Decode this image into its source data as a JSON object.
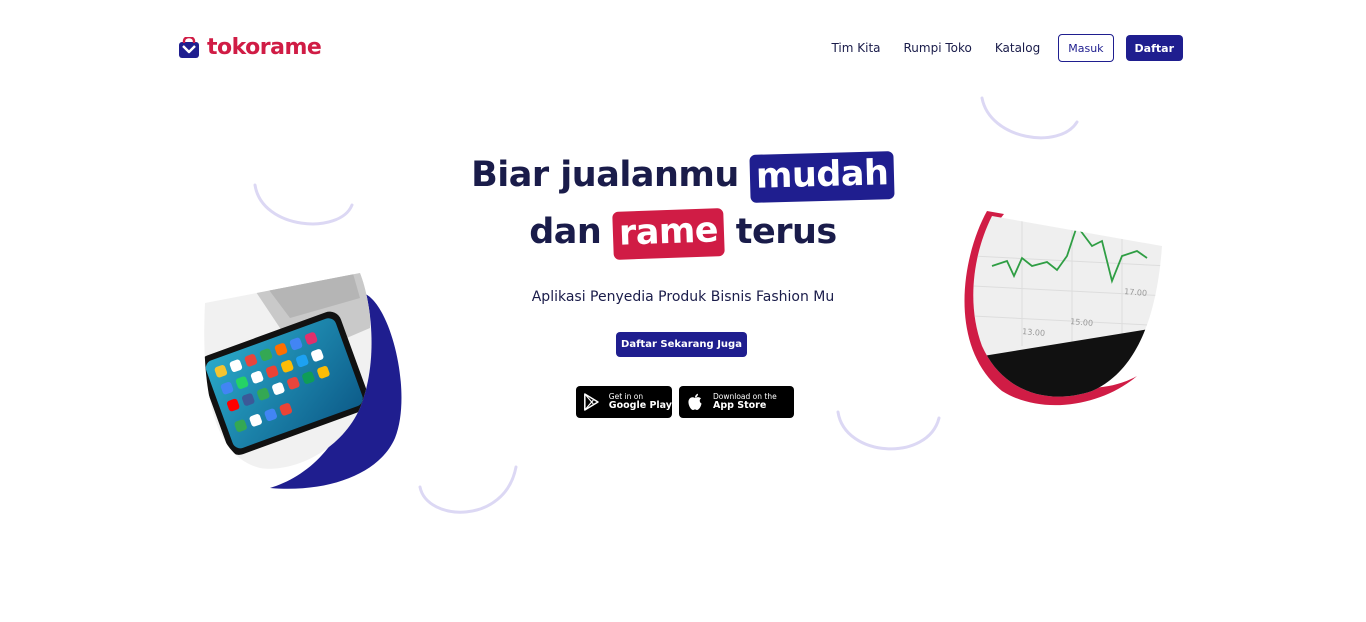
{
  "brand": {
    "name": "tokorame",
    "color": "#d01c45"
  },
  "nav": {
    "links": [
      "Tim Kita",
      "Rumpi Toko",
      "Katalog"
    ],
    "login_label": "Masuk",
    "register_label": "Daftar"
  },
  "hero": {
    "line1_prefix": "Biar jualanmu",
    "line1_highlight": "mudah",
    "line2_prefix": "dan",
    "line2_highlight": "rame",
    "line2_suffix": "terus",
    "subtitle": "Aplikasi Penyedia Produk Bisnis Fashion Mu",
    "cta_label": "Daftar Sekarang Juga"
  },
  "stores": {
    "google_play": {
      "small": "Get in on",
      "big": "Google Play",
      "icon": "google-play-icon"
    },
    "app_store": {
      "small": "Download on the",
      "big": "App Store",
      "icon": "apple-icon"
    }
  },
  "illustrations": {
    "left": "phone-photo",
    "right": "stock-chart-photo",
    "chart_ticks": [
      "13.00",
      "15.00",
      "17.00"
    ]
  },
  "colors": {
    "primary": "#1f1e8f",
    "accent": "#d01c45",
    "text": "#1a1c4a",
    "decor": "#dcd8f4"
  }
}
